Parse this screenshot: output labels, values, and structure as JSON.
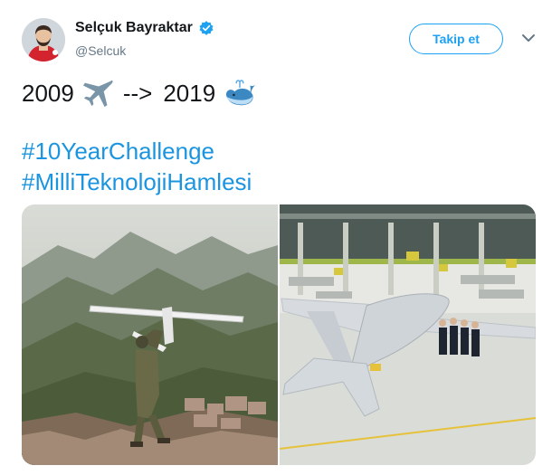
{
  "author": {
    "name": "Selçuk Bayraktar",
    "handle": "@Selcuk",
    "verified": true
  },
  "follow_button": {
    "label": "Takip et"
  },
  "tweet": {
    "year_then": "2009",
    "arrow": "-->",
    "year_now": "2019",
    "emoji_then": "airplane-emoji",
    "emoji_now": "whale-emoji",
    "hashtags": [
      "#10YearChallenge",
      "#MilliTeknolojiHamlesi"
    ]
  },
  "media": [
    {
      "name": "hand-launched-drone-photo"
    },
    {
      "name": "hangar-drone-photo"
    }
  ],
  "colors": {
    "accent": "#1da1f2",
    "hashtag": "#1b95e0",
    "text": "#14171a",
    "muted": "#657786"
  }
}
